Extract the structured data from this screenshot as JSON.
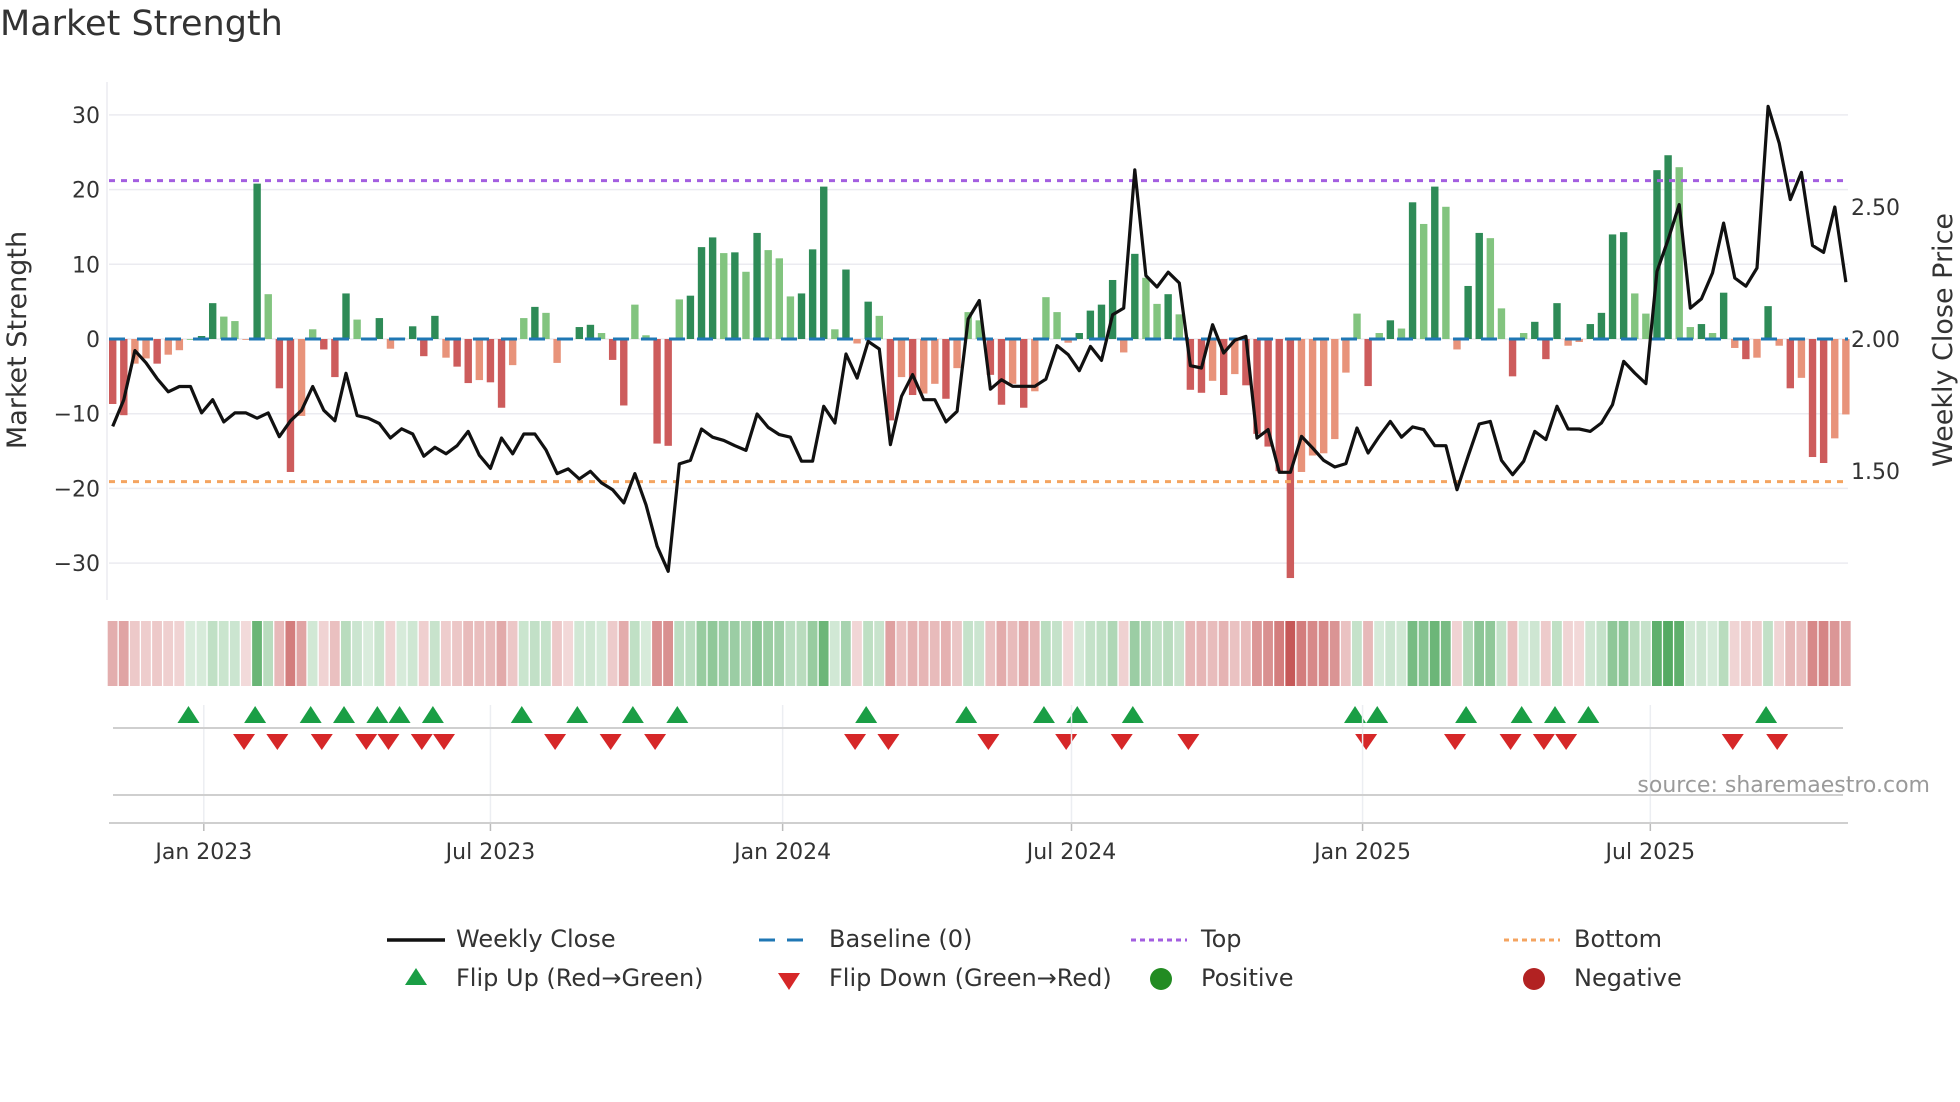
{
  "title": "Market Strength",
  "source_note": "source: sharemaestro.com",
  "legend": {
    "weekly_close": "Weekly Close",
    "baseline": "Baseline (0)",
    "top": "Top",
    "bottom": "Bottom",
    "flip_up": "Flip Up (Red→Green)",
    "flip_down": "Flip Down (Green→Red)",
    "positive": "Positive",
    "negative": "Negative"
  },
  "colors": {
    "strong_green": "#2e8b57",
    "weak_green": "#82c47f",
    "strong_red": "#cd5c5c",
    "weak_red": "#e8937a",
    "top_line": "#a35ee0",
    "bottom_line": "#f4a460",
    "baseline": "#1f77b4",
    "flip_up": "#1a9e45",
    "flip_down": "#d62728",
    "positive": "#228b22",
    "negative": "#b22222",
    "close_line": "#111111"
  },
  "chart_data": {
    "type": "bar",
    "title": "Market Strength",
    "xlabel": "",
    "ylabel": "Market Strength",
    "y2label": "Weekly Close Price",
    "ylim": [
      -30,
      30
    ],
    "y2lim": [
      1.5,
      2.5
    ],
    "grid": true,
    "legend_position": "bottom",
    "yticks": [
      30,
      20,
      10,
      0,
      -10,
      -20,
      -30
    ],
    "ytick_labels": [
      "30",
      "20",
      "10",
      "0",
      "−10",
      "−20",
      "−30"
    ],
    "y2ticks": [
      2.5,
      2.0,
      1.5
    ],
    "y2tick_labels": [
      "2.50",
      "2.00",
      "1.50"
    ],
    "xticks_week_index": [
      8.2,
      34.0,
      60.3,
      86.3,
      112.5,
      138.4
    ],
    "xtick_labels": [
      "Jan 2023",
      "Jul 2023",
      "Jan 2024",
      "Jul 2024",
      "Jan 2025",
      "Jul 2025"
    ],
    "top_level": 21.2,
    "bottom_level": -19.1,
    "baseline_level": 0,
    "strength": [
      -8.7,
      -10.2,
      -3.3,
      -2.6,
      -3.3,
      -2.1,
      -1.5,
      0,
      0.4,
      4.8,
      3.0,
      2.4,
      -0.1,
      20.8,
      6.0,
      -6.6,
      -17.8,
      -10.3,
      1.3,
      -1.4,
      -5.1,
      6.1,
      2.6,
      0,
      2.8,
      -1.3,
      0.2,
      1.7,
      -2.3,
      3.1,
      -2.5,
      -3.7,
      -5.9,
      -5.5,
      -5.8,
      -9.2,
      -3.5,
      2.8,
      4.3,
      3.5,
      -3.2,
      -0.2,
      1.6,
      1.9,
      0.8,
      -2.8,
      -8.9,
      4.6,
      0.5,
      -14.0,
      -14.3,
      5.3,
      5.8,
      12.3,
      13.6,
      11.5,
      11.6,
      9.0,
      14.2,
      11.9,
      10.8,
      5.7,
      6.1,
      12.0,
      20.4,
      1.3,
      9.3,
      -0.6,
      5.0,
      3.1,
      -10.9,
      -5.1,
      -7.5,
      -7.3,
      -6.0,
      -8.0,
      -3.9,
      3.6,
      2.5,
      -4.8,
      -8.8,
      -6.0,
      -9.2,
      -7.0,
      5.6,
      3.6,
      -0.5,
      0.8,
      3.8,
      4.6,
      7.9,
      -1.8,
      11.4,
      8.2,
      4.7,
      6.0,
      3.3,
      -6.8,
      -7.2,
      -5.6,
      -7.5,
      -4.7,
      -6.2,
      -12.7,
      -14.4,
      -17.7,
      -32.0,
      -17.8,
      -15.6,
      -15.3,
      -13.4,
      -4.5,
      3.4,
      -6.3,
      0.8,
      2.5,
      1.4,
      18.3,
      15.4,
      20.4,
      17.7,
      -1.4,
      7.1,
      14.2,
      13.5,
      4.1,
      -5.0,
      0.8,
      2.3,
      -2.7,
      4.8,
      -0.9,
      -0.4,
      2.0,
      3.5,
      14.0,
      14.3,
      6.1,
      3.4,
      22.6,
      24.6,
      23.0,
      1.6,
      2.0,
      0.8,
      6.2,
      -1.2,
      -2.7,
      -2.5,
      4.4,
      -0.9,
      -6.6,
      -5.2,
      -15.8,
      -16.6,
      -13.3,
      -10.1
    ],
    "weekly_close": [
      1.669,
      1.77,
      1.956,
      1.91,
      1.85,
      1.8,
      1.82,
      1.82,
      1.72,
      1.77,
      1.686,
      1.72,
      1.72,
      1.7,
      1.72,
      1.63,
      1.69,
      1.73,
      1.82,
      1.73,
      1.69,
      1.87,
      1.71,
      1.7,
      1.68,
      1.625,
      1.66,
      1.64,
      1.556,
      1.59,
      1.565,
      1.596,
      1.65,
      1.56,
      1.51,
      1.625,
      1.565,
      1.64,
      1.64,
      1.58,
      1.49,
      1.508,
      1.47,
      1.499,
      1.455,
      1.429,
      1.379,
      1.49,
      1.372,
      1.215,
      1.12,
      1.527,
      1.54,
      1.659,
      1.628,
      1.616,
      1.596,
      1.578,
      1.716,
      1.665,
      1.638,
      1.628,
      1.537,
      1.537,
      1.745,
      1.682,
      1.943,
      1.852,
      1.991,
      1.962,
      1.6,
      1.783,
      1.865,
      1.77,
      1.77,
      1.686,
      1.726,
      2.076,
      2.146,
      1.81,
      1.846,
      1.821,
      1.821,
      1.821,
      1.848,
      1.975,
      1.941,
      1.88,
      1.972,
      1.919,
      2.092,
      2.117,
      2.641,
      2.24,
      2.197,
      2.253,
      2.212,
      1.899,
      1.89,
      2.054,
      1.947,
      1.995,
      2.01,
      1.625,
      1.657,
      1.495,
      1.495,
      1.631,
      1.587,
      1.54,
      1.515,
      1.528,
      1.663,
      1.568,
      1.631,
      1.688,
      1.628,
      1.667,
      1.657,
      1.596,
      1.596,
      1.429,
      1.556,
      1.678,
      1.688,
      1.54,
      1.486,
      1.537,
      1.65,
      1.619,
      1.745,
      1.659,
      1.659,
      1.65,
      1.682,
      1.751,
      1.915,
      1.871,
      1.831,
      2.256,
      2.376,
      2.509,
      2.117,
      2.152,
      2.25,
      2.439,
      2.231,
      2.2,
      2.269,
      2.881,
      2.742,
      2.528,
      2.631,
      2.354,
      2.328,
      2.5,
      2.215
    ],
    "flip_up_weeks": [
      7,
      13,
      18,
      21,
      24,
      26,
      29,
      37,
      42,
      47,
      51,
      68,
      77,
      84,
      87,
      92,
      112,
      114,
      122,
      127,
      130,
      133,
      149
    ],
    "flip_down_weeks": [
      12,
      15,
      19,
      23,
      25,
      28,
      30,
      40,
      45,
      49,
      67,
      70,
      79,
      86,
      91,
      97,
      113,
      121,
      126,
      129,
      131,
      146,
      150
    ]
  }
}
